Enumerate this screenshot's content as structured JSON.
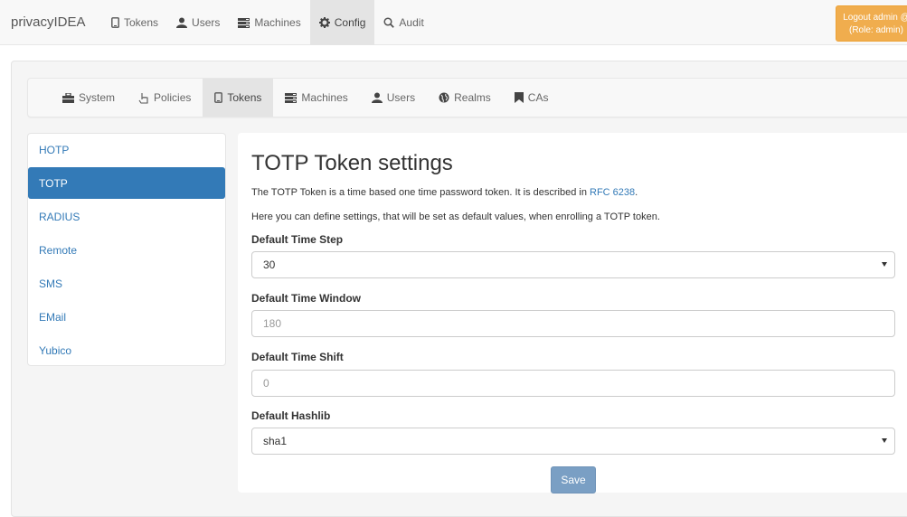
{
  "topbar": {
    "brand": "privacyIDEA",
    "nav": [
      {
        "label": "Tokens",
        "icon": "phone-icon"
      },
      {
        "label": "Users",
        "icon": "user-icon"
      },
      {
        "label": "Machines",
        "icon": "machines-icon"
      },
      {
        "label": "Config",
        "icon": "gear-icon"
      },
      {
        "label": "Audit",
        "icon": "search-icon"
      }
    ],
    "logout_line1": "Logout admin @",
    "logout_line2": "(Role: admin)"
  },
  "subnav": {
    "items": [
      {
        "label": "System",
        "icon": "briefcase-icon"
      },
      {
        "label": "Policies",
        "icon": "hand-icon"
      },
      {
        "label": "Tokens",
        "icon": "phone-icon"
      },
      {
        "label": "Machines",
        "icon": "machines-icon"
      },
      {
        "label": "Users",
        "icon": "user-icon"
      },
      {
        "label": "Realms",
        "icon": "globe-icon"
      },
      {
        "label": "CAs",
        "icon": "bookmark-icon"
      }
    ]
  },
  "token_types": [
    "HOTP",
    "TOTP",
    "RADIUS",
    "Remote",
    "SMS",
    "EMail",
    "Yubico"
  ],
  "panel": {
    "title": "TOTP Token settings",
    "desc_prefix": "The TOTP Token is a time based one time password token. It is described in ",
    "rfc_link": "RFC 6238",
    "desc_suffix": ".",
    "desc2": "Here you can define settings, that will be set as default values, when enrolling a TOTP token.",
    "time_step_label": "Default Time Step",
    "time_step_value": "30",
    "time_window_label": "Default Time Window",
    "time_window_placeholder": "180",
    "time_shift_label": "Default Time Shift",
    "time_shift_placeholder": "0",
    "hashlib_label": "Default Hashlib",
    "hashlib_value": "sha1",
    "save_label": "Save"
  },
  "colors": {
    "accent": "#337ab7",
    "logout": "#f0ad4e",
    "save": "#7a9fc4"
  }
}
